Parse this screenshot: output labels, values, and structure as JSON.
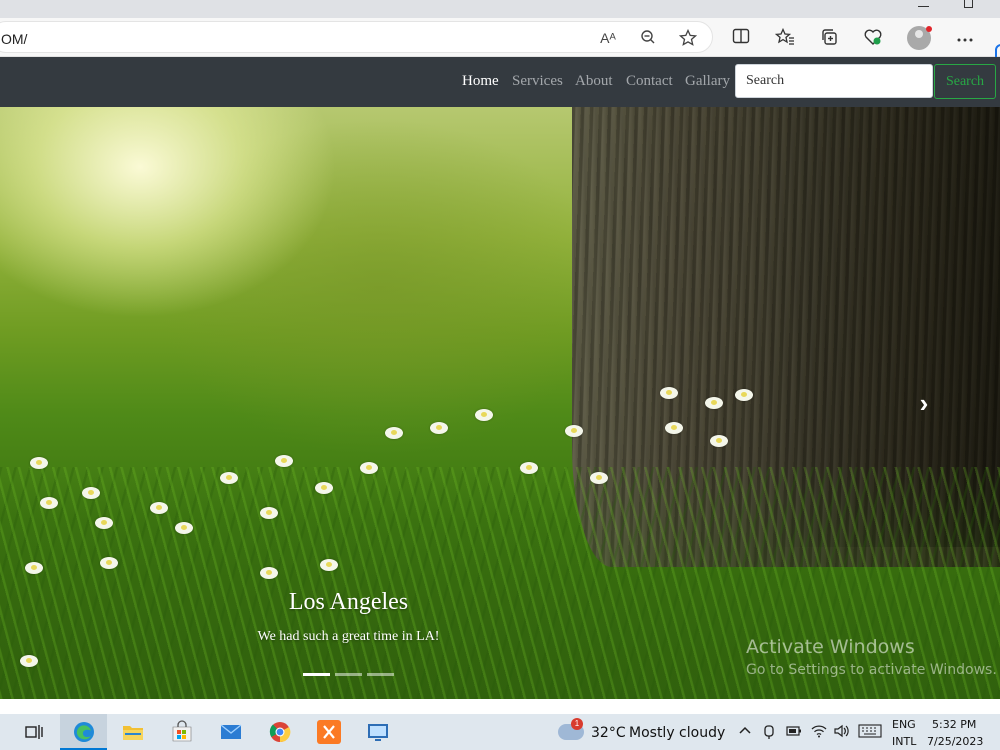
{
  "browser": {
    "url": "OM/",
    "read_aloud_icon": "Aᴬ",
    "zoom_icon": "zoom-out-icon",
    "favorite_icon": "star-icon"
  },
  "navbar": {
    "links": [
      {
        "label": "Home",
        "active": true
      },
      {
        "label": "Services"
      },
      {
        "label": "About"
      },
      {
        "label": "Contact"
      },
      {
        "label": "Gallary"
      }
    ],
    "search_placeholder": "Search",
    "search_button": "Search",
    "accent": "#28a745",
    "background": "#343a40"
  },
  "carousel": {
    "caption_title": "Los Angeles",
    "caption_text": "We had such a great time in LA!",
    "slides": 3,
    "active_slide": 0,
    "next_icon": "›"
  },
  "watermark": {
    "title": "Activate Windows",
    "subtitle": "Go to Settings to activate Windows."
  },
  "taskbar": {
    "weather_badge": "1",
    "temperature": "32°C",
    "weather": "Mostly cloudy",
    "language_top": "ENG",
    "language_bottom": "INTL",
    "time": "5:32 PM",
    "date": "7/25/2023"
  }
}
